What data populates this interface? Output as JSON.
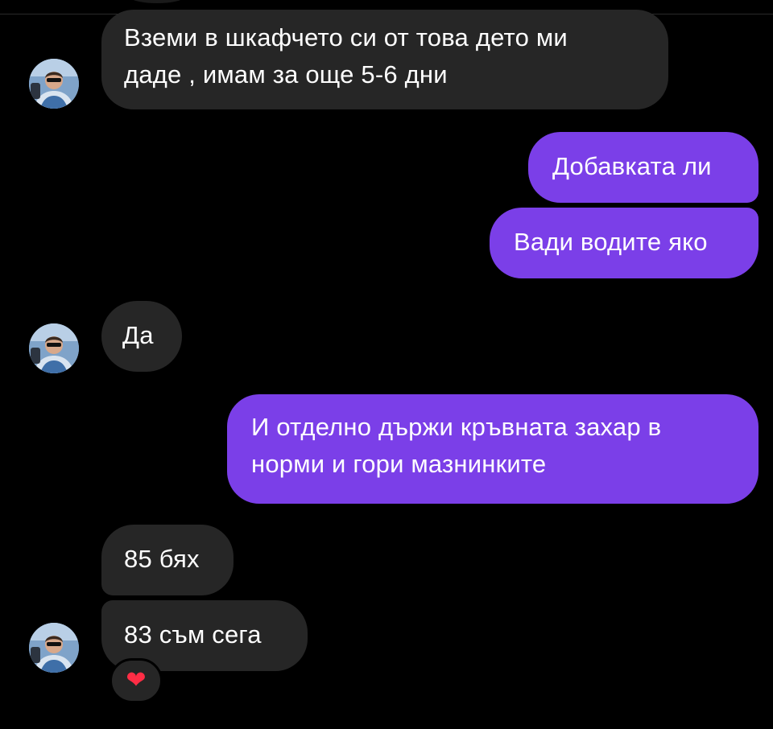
{
  "messages": [
    {
      "id": "m1",
      "direction": "incoming",
      "text": "Вземи в шкафчето си от това дето ми даде , имам за още 5-6 дни"
    },
    {
      "id": "m2",
      "direction": "outgoing",
      "text": "Добавката ли"
    },
    {
      "id": "m3",
      "direction": "outgoing",
      "text": "Вади водите яко"
    },
    {
      "id": "m4",
      "direction": "incoming",
      "text": "Да"
    },
    {
      "id": "m5",
      "direction": "outgoing",
      "text": "И отделно държи кръвната захар в норми и гори мазнинките"
    },
    {
      "id": "m6",
      "direction": "incoming",
      "text": "85 бях"
    },
    {
      "id": "m7",
      "direction": "incoming",
      "text": "83 съм сега"
    }
  ],
  "bubble_lines": {
    "m1_line1": "Вземи в шкафчето си от това дето ми",
    "m1_line2": "даде , имам за още 5-6 дни",
    "m5_line1": "И отделно държи кръвната захар в",
    "m5_line2": "норми и гори мазнинките"
  },
  "reaction": {
    "emoji": "❤",
    "name": "heart"
  },
  "colors": {
    "background": "#000000",
    "incoming_bubble": "#262626",
    "outgoing_bubble": "#7b3fe8",
    "text": "#ffffff",
    "reaction": "#ff2d45"
  },
  "icons": {
    "avatar": "contact-avatar-icon",
    "reaction": "heart-reaction-icon"
  }
}
